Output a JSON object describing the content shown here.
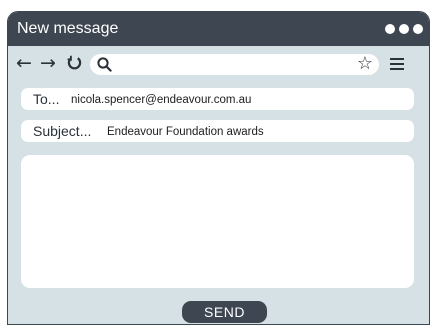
{
  "window": {
    "title": "New message"
  },
  "navbar": {
    "back_icon": "←",
    "forward_icon": "→",
    "reload_icon": "↻",
    "star_icon": "☆",
    "search_value": ""
  },
  "compose": {
    "to_label": "To...",
    "to_value": "nicola.spencer@endeavour.com.au",
    "subject_label": "Subject...",
    "subject_value": "Endeavour Foundation awards",
    "body_value": "",
    "send_label": "SEND"
  },
  "colors": {
    "titlebar": "#3d4651",
    "window_bg": "#d6e1e6",
    "field_bg": "#ffffff"
  }
}
